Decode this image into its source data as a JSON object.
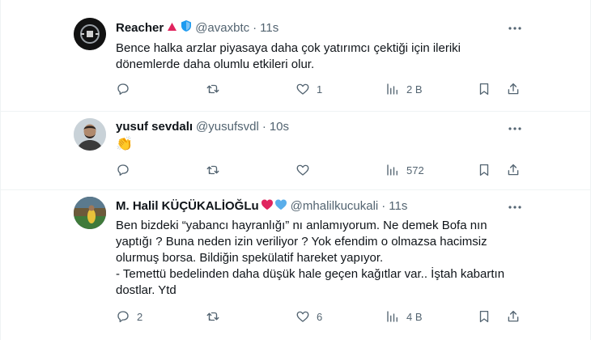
{
  "tweets": [
    {
      "name": "Reacher",
      "handle": "@avaxbtc",
      "separator": "·",
      "time": "11s",
      "lines": [
        "Bence halka arzlar piyasaya daha çok yatırımcı çektiği için ileriki",
        "dönemlerde daha olumlu etkileri olur."
      ],
      "counts": {
        "reply": "",
        "retweet": "",
        "like": "1",
        "views": "2 B"
      },
      "avatar_icon": "dark-logo-avatar",
      "badges": [
        "red-triangle-icon",
        "blue-shield-icon"
      ]
    },
    {
      "name": "yusuf sevdalı",
      "handle": "@yusufsvdl",
      "separator": "·",
      "time": "10s",
      "lines": [
        "👏"
      ],
      "counts": {
        "reply": "",
        "retweet": "",
        "like": "",
        "views": "572"
      },
      "avatar_icon": "person-photo-avatar",
      "badges": []
    },
    {
      "name": "M. Halil KÜÇÜKALİOĞLu",
      "handle": "@mhalilkucukali",
      "separator": "·",
      "time": "11s",
      "lines": [
        "Ben bizdeki “yabancı hayranlığı” nı anlamıyorum. Ne demek Bofa nın",
        "yaptığı ?  Buna neden izin veriliyor ? Yok efendim o olmazsa hacimsiz",
        "olurmuş borsa. Bildiğin spekülatif hareket yapıyor.",
        "- Temettü bedelinden daha düşük hale geçen kağıtlar var.. İştah kabartın",
        "dostlar. Ytd"
      ],
      "counts": {
        "reply": "2",
        "retweet": "",
        "like": "6",
        "views": "4 B"
      },
      "avatar_icon": "stadium-photo-avatar",
      "badges": [
        "red-heart-icon",
        "blue-heart-icon"
      ]
    }
  ],
  "colors": {
    "text": "#0f1419",
    "muted": "#536471",
    "divider": "#eff3f4",
    "verified_blue": "#1d9bf0"
  }
}
